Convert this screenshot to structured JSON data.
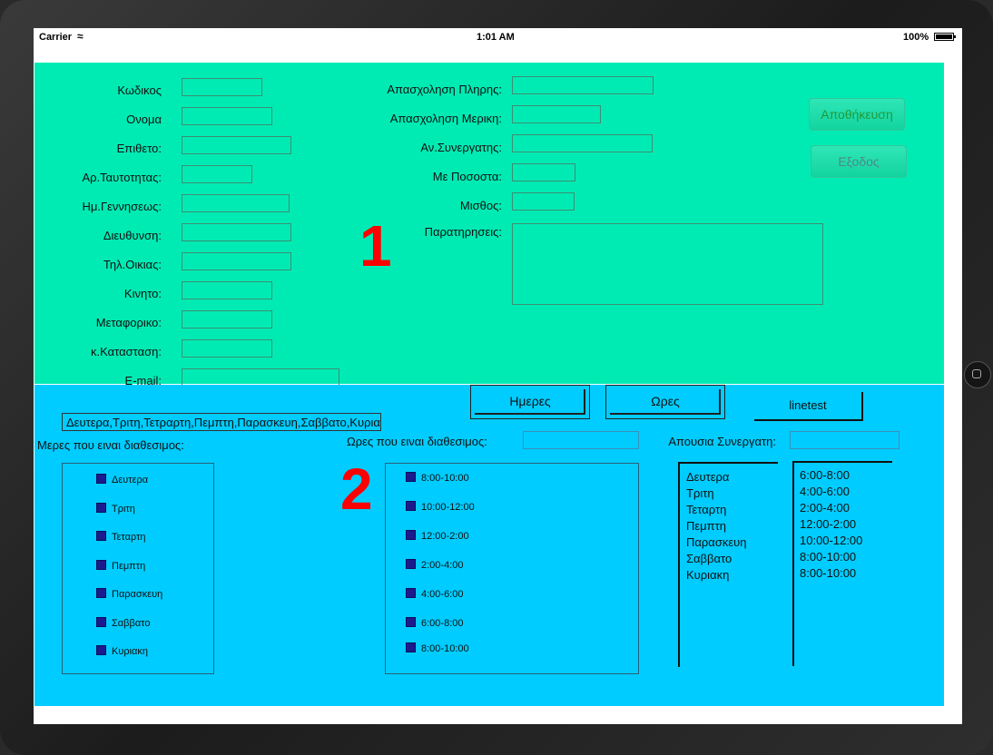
{
  "status_bar": {
    "carrier": "Carrier",
    "time": "1:01 AM",
    "battery": "100%"
  },
  "form": {
    "fields_left": [
      {
        "label": "Κωδικος",
        "value": ""
      },
      {
        "label": "Ονομα",
        "value": ""
      },
      {
        "label": "Επιθετο:",
        "value": ""
      },
      {
        "label": "Αρ.Ταυτοτητας:",
        "value": ""
      },
      {
        "label": "Ημ.Γεννησεως:",
        "value": ""
      },
      {
        "label": "Διευθυνση:",
        "value": ""
      },
      {
        "label": "Τηλ.Οικιας:",
        "value": ""
      },
      {
        "label": "Κινητο:",
        "value": ""
      },
      {
        "label": "Μεταφορικο:",
        "value": ""
      },
      {
        "label": "κ.Κατασταση:",
        "value": ""
      },
      {
        "label": "E-mail:",
        "value": ""
      }
    ],
    "fields_right": [
      {
        "label": "Απασχοληση Πληρης:",
        "value": ""
      },
      {
        "label": "Απασχοληση Μερικη:",
        "value": ""
      },
      {
        "label": "Αν.Συνεργατης:",
        "value": ""
      },
      {
        "label": "Με Ποσοστα:",
        "value": ""
      },
      {
        "label": "Μισθος:",
        "value": ""
      }
    ],
    "remarks": {
      "label": "Παρατηρησεις:",
      "value": ""
    },
    "section_number": "1",
    "save_label": "Αποθήκευση",
    "exit_label": "Εξοδος"
  },
  "availability": {
    "section_number": "2",
    "days_button": "Ημερες",
    "hours_button": "Ωρες",
    "linetest_button": "linetest",
    "days_summary": "Δευτερα,Τριτη,Τετραρτη,Πεμπτη,Παρασκευη,Σαββατο,Κυριακη",
    "days_label": "Μερες που ειναι διαθεσιμος:",
    "hours_label": "Ωρες που ειναι διαθεσιμος:",
    "hours_value": "",
    "absence_label": "Απουσια Συνεργατη:",
    "absence_value": "",
    "days": [
      "Δευτερα",
      "Τριτη",
      "Τεταρτη",
      "Πεμπτη",
      "Παρασκευη",
      "Σαββατο",
      "Κυριακη"
    ],
    "hours": [
      "8:00-10:00",
      "10:00-12:00",
      "12:00-2:00",
      "2:00-4:00",
      "4:00-6:00",
      "6:00-8:00",
      "8:00-10:00"
    ],
    "schedule_days": [
      "Δευτερα",
      "Τριτη",
      "Τεταρτη",
      "Πεμπτη",
      "Παρασκευη",
      "Σαββατο",
      "Κυριακη"
    ],
    "schedule_hours": [
      "6:00-8:00",
      "4:00-6:00",
      "2:00-4:00",
      "12:00-2:00",
      "10:00-12:00",
      "8:00-10:00",
      "8:00-10:00"
    ]
  },
  "colors": {
    "top_panel": "#00ebb4",
    "bottom_panel": "#00ccff",
    "checkbox": "#1b1b8f",
    "section_number": "#ff0000"
  }
}
